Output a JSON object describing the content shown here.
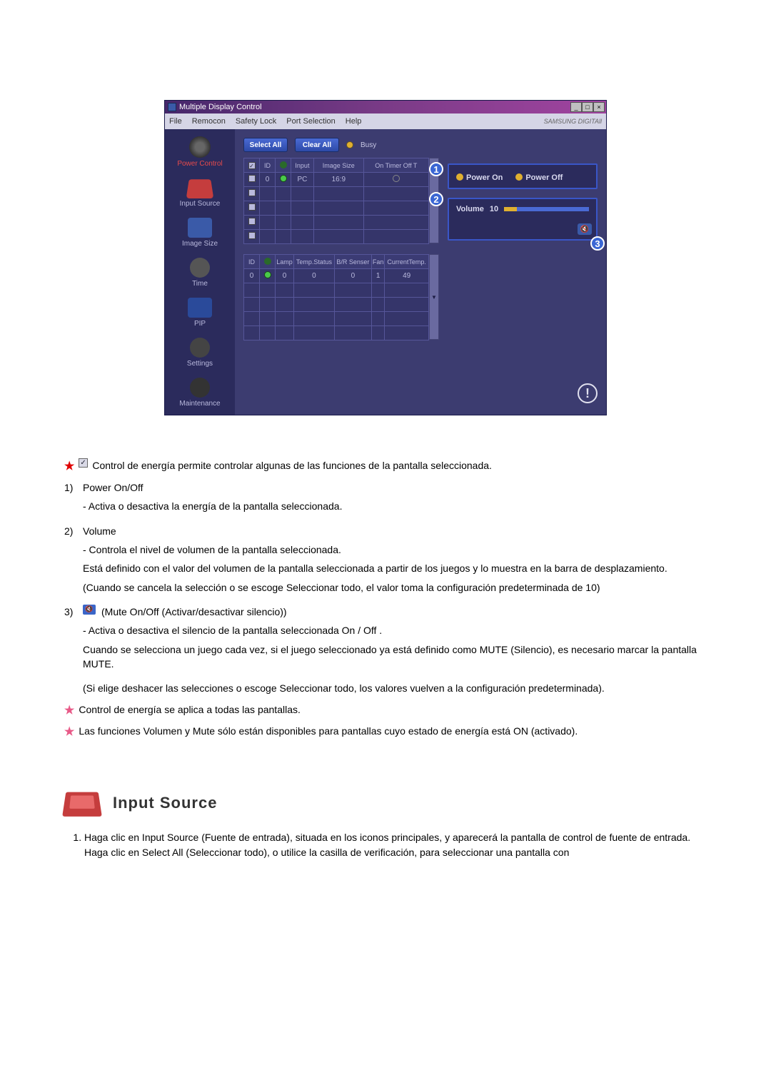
{
  "app": {
    "title": "Multiple Display Control",
    "menus": [
      "File",
      "Remocon",
      "Safety Lock",
      "Port Selection",
      "Help"
    ],
    "brand": "SAMSUNG DIGITAll",
    "window_buttons": {
      "min": "_",
      "max": "□",
      "close": "×"
    }
  },
  "sidebar": {
    "items": [
      {
        "label": "Power Control",
        "active": true
      },
      {
        "label": "Input Source",
        "active": false
      },
      {
        "label": "Image Size",
        "active": false
      },
      {
        "label": "Time",
        "active": false
      },
      {
        "label": "PIP",
        "active": false
      },
      {
        "label": "Settings",
        "active": false
      },
      {
        "label": "Maintenance",
        "active": false
      }
    ]
  },
  "toolbar": {
    "select_all": "Select All",
    "clear_all": "Clear All",
    "busy": "Busy"
  },
  "table1": {
    "headers": [
      "",
      "ID",
      "",
      "Input",
      "Image Size",
      "On Timer Off T"
    ],
    "row": {
      "id": "0",
      "input": "PC",
      "image_size": "16:9"
    }
  },
  "table2": {
    "headers": [
      "ID",
      "",
      "Lamp",
      "Temp.Status",
      "B/R Senser",
      "Fan",
      "CurrentTemp."
    ],
    "row": {
      "id": "0",
      "lamp": "0",
      "temp_status": "0",
      "br": "0",
      "fan": "1",
      "ctemp": "49"
    }
  },
  "right_panel": {
    "power_on": "Power On",
    "power_off": "Power Off",
    "volume_label": "Volume",
    "volume_value": "10"
  },
  "callouts": {
    "c1": "1",
    "c2": "2",
    "c3": "3"
  },
  "desc": {
    "intro": "Control de energía permite controlar algunas de las funciones de la pantalla seleccionada.",
    "n1_title": "Power On/Off",
    "n1_a": "- Activa o desactiva la energía de la pantalla seleccionada.",
    "n2_title": "Volume",
    "n2_a": "- Controla el nivel de volumen de la pantalla seleccionada.",
    "n2_b": "Está definido con el valor del volumen de la pantalla seleccionada a partir de los juegos y lo muestra en la barra de desplazamiento.",
    "n2_c": "(Cuando se cancela la selección o se escoge Seleccionar todo, el valor toma la configuración predeterminada de 10)",
    "n3_title": "(Mute On/Off (Activar/desactivar silencio))",
    "n3_a": "- Activa o desactiva el silencio de la pantalla seleccionada On / Off .",
    "n3_b": "Cuando se selecciona un juego cada vez, si el juego seleccionado ya está definido como MUTE (Silencio), es necesario marcar la pantalla MUTE.",
    "n3_c": "(Si elige deshacer las selecciones o escoge Seleccionar todo, los valores vuelven a la configuración predeterminada).",
    "note1": "Control de energía se aplica a todas las pantallas.",
    "note2": "Las funciones Volumen y Mute sólo están disponibles para pantallas cuyo estado de energía está ON (activado)."
  },
  "section": {
    "title": "Input Source",
    "step1a": "Haga clic en Input Source (Fuente de entrada), situada en los iconos principales, y aparecerá la pantalla de control de fuente de entrada.",
    "step1b": "Haga clic en Select All (Seleccionar todo), o utilice la casilla de verificación, para seleccionar una pantalla con"
  }
}
